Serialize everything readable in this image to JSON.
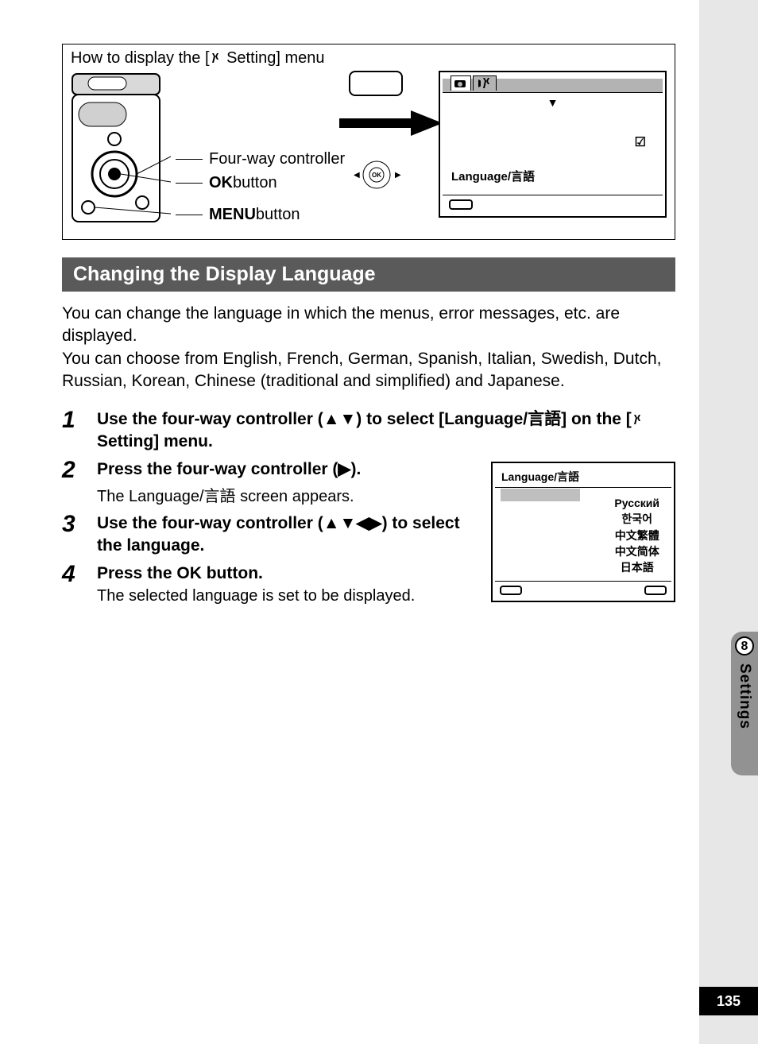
{
  "diagram": {
    "title_pre": "How to display the [",
    "title_post": " Setting] menu",
    "labels": {
      "fourway": "Four-way controller",
      "ok": "OK",
      "ok_suffix": " button",
      "menu": "MENU",
      "menu_suffix": " button"
    },
    "lcd": {
      "language_label": "Language/言語"
    }
  },
  "section_title": "Changing the Display Language",
  "paragraph": "You can change the language in which the menus, error messages, etc. are displayed.\nYou can choose from English, French, German, Spanish, Italian, Swedish, Dutch, Russian, Korean, Chinese (traditional and simplified) and Japanese.",
  "steps": [
    {
      "num": "1",
      "head_pre": "Use the four-way controller (▲▼) to select [Language/言語] on the [",
      "head_post": " Setting] menu."
    },
    {
      "num": "2",
      "head": "Press the four-way controller (▶).",
      "sub": "The Language/言語 screen appears."
    },
    {
      "num": "3",
      "head": "Use the four-way controller (▲▼◀▶) to select the language."
    },
    {
      "num": "4",
      "head_pre": "Press the ",
      "head_ok": "OK",
      "head_post": " button.",
      "sub": "The selected language is set to be displayed."
    }
  ],
  "lang_screen": {
    "title": "Language/言語",
    "options": [
      "Русский",
      "한국어",
      "中文繁體",
      "中文简体",
      "日本語"
    ]
  },
  "sidebar": {
    "chapter_num": "8",
    "chapter_label": "Settings"
  },
  "page_number": "135"
}
